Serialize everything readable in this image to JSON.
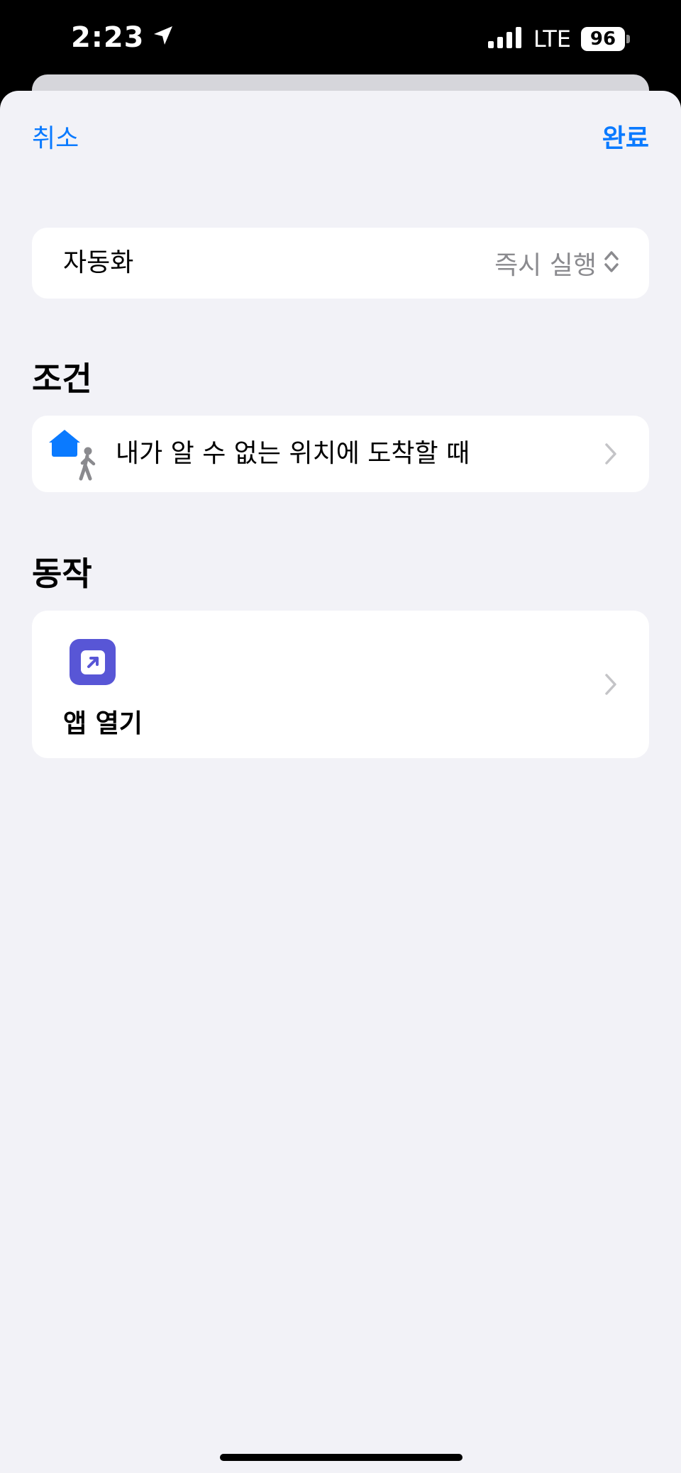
{
  "status_bar": {
    "time": "2:23",
    "network": "LTE",
    "battery": "96"
  },
  "nav": {
    "cancel_label": "취소",
    "done_label": "완료"
  },
  "automation": {
    "label": "자동화",
    "value": "즉시 실행"
  },
  "conditions": {
    "title": "조건",
    "item_label": "내가 알 수 없는 위치에 도착할 때"
  },
  "actions": {
    "title": "동작",
    "item_label": "앱 열기"
  },
  "colors": {
    "accent": "#0a7aff",
    "action_icon": "#5856d6",
    "background": "#f2f2f7"
  },
  "icons": {
    "location": "location-arrow-icon",
    "signal": "cellular-signal-icon",
    "updown": "chevron-up-down-icon",
    "condition": "home-person-icon",
    "action": "open-app-icon",
    "disclosure": "chevron-right-icon"
  }
}
